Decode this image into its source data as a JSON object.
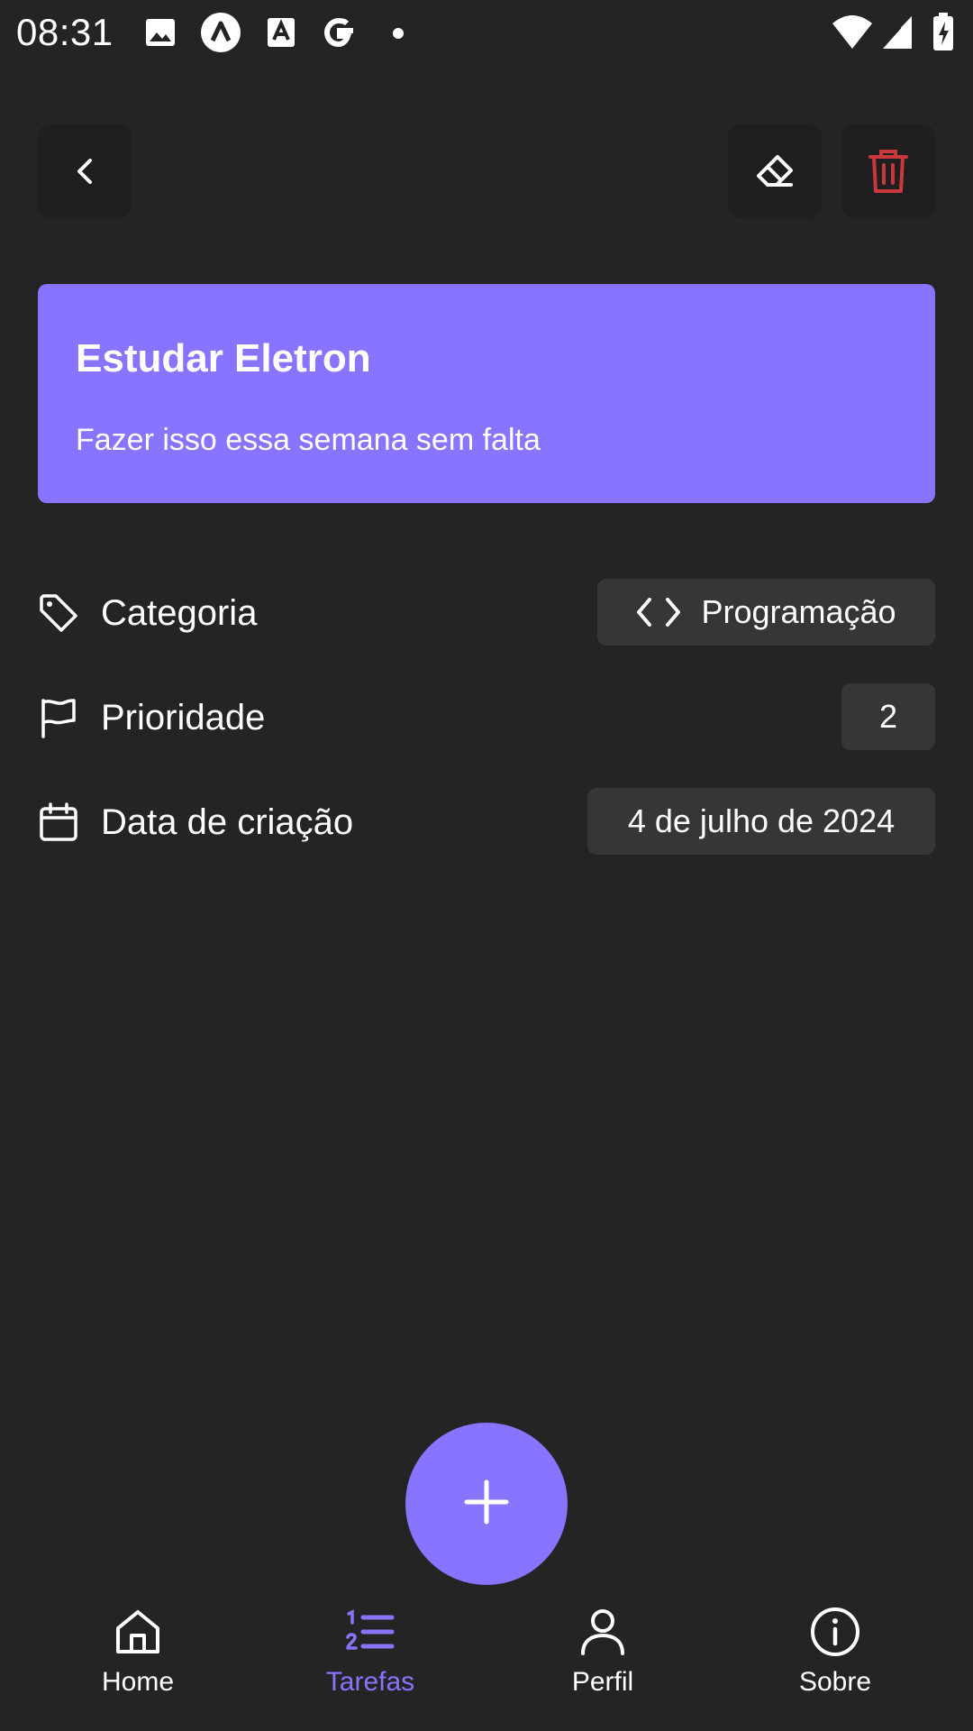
{
  "status_bar": {
    "time": "08:31",
    "left_icons": [
      "image-icon",
      "app-circle-icon",
      "font-app-icon",
      "google-icon",
      "dot-icon"
    ],
    "right_icons": [
      "wifi-icon",
      "signal-icon",
      "battery-charging-icon"
    ]
  },
  "toolbar": {
    "back_icon": "chevron-left-icon",
    "edit_icon": "eraser-icon",
    "delete_icon": "trash-icon",
    "delete_color": "#c8383d"
  },
  "task": {
    "title": "Estudar Eletron",
    "description": "Fazer isso essa semana sem falta",
    "card_color": "#8875ff"
  },
  "details": [
    {
      "icon": "tag-icon",
      "label": "Categoria",
      "value": "Programação",
      "value_icon": "code-icon"
    },
    {
      "icon": "flag-icon",
      "label": "Prioridade",
      "value": "2"
    },
    {
      "icon": "calendar-icon",
      "label": "Data de criação",
      "value": "4 de julho de 2024"
    }
  ],
  "fab": {
    "icon": "plus-icon"
  },
  "bottom_nav": {
    "items": [
      {
        "label": "Home",
        "icon": "home-icon",
        "active": false
      },
      {
        "label": "Tarefas",
        "icon": "list-numbered-icon",
        "active": true
      },
      {
        "label": "Perfil",
        "icon": "user-icon",
        "active": false
      },
      {
        "label": "Sobre",
        "icon": "info-icon",
        "active": false
      }
    ],
    "active_color": "#8875ff"
  }
}
